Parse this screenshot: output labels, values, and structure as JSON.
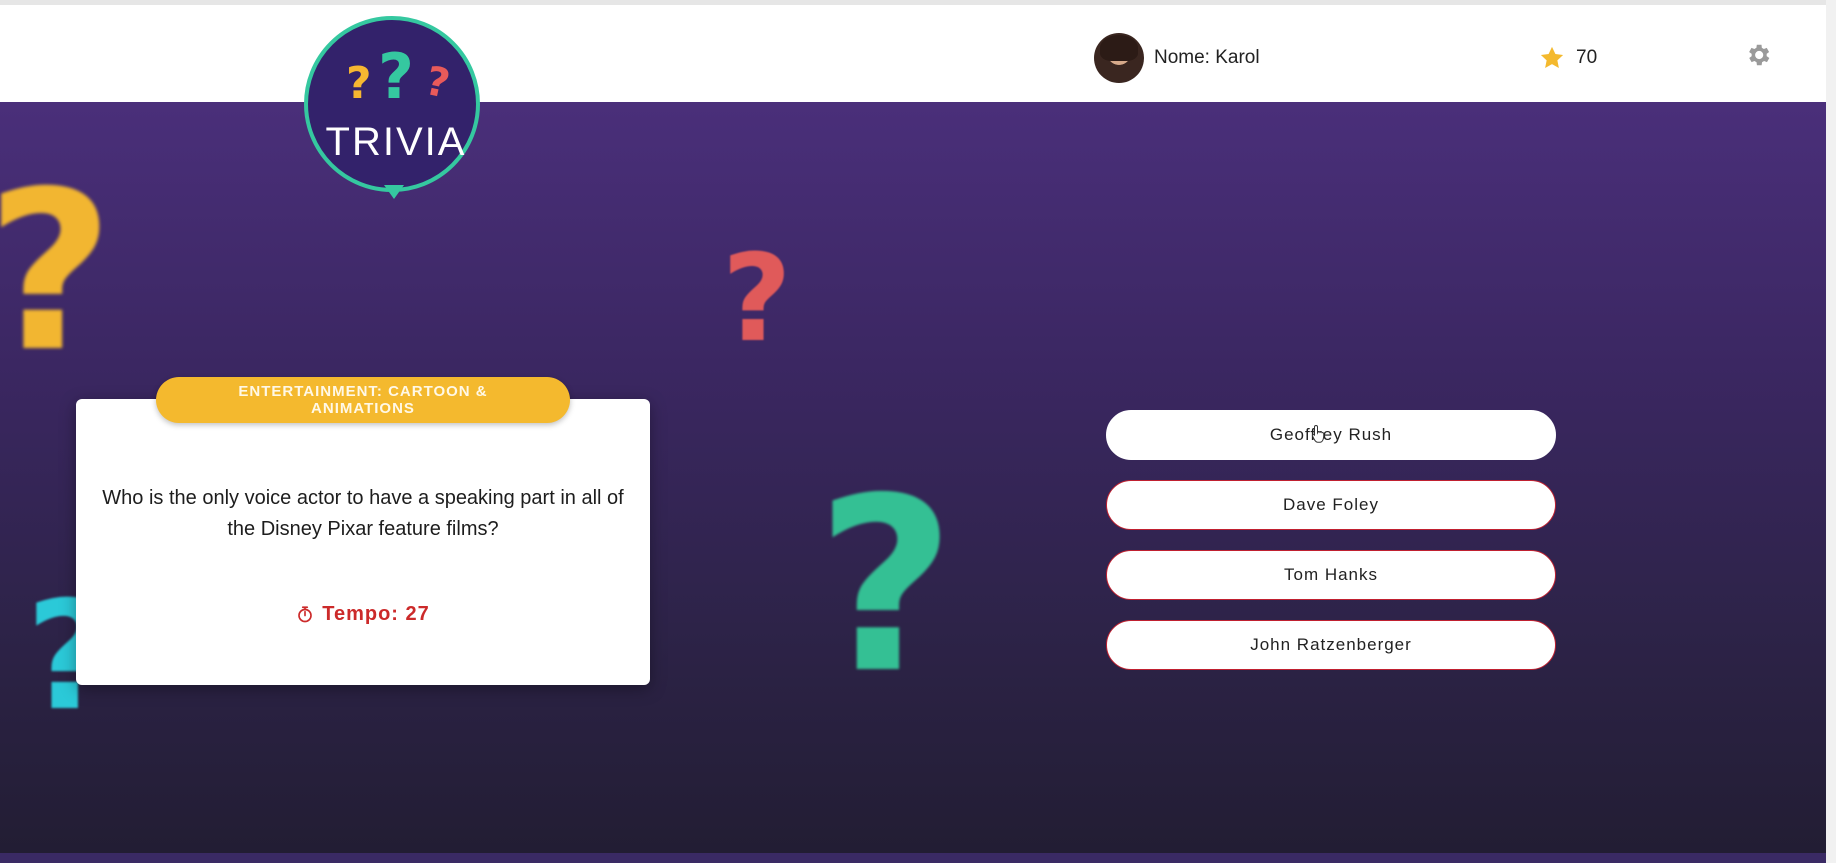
{
  "header": {
    "logo": {
      "text": "TRIVIA",
      "marks": [
        "?",
        "?",
        "?"
      ]
    },
    "user": {
      "name_label": "Nome: Karol",
      "avatar_icon": "user-avatar"
    },
    "score": {
      "value": "70",
      "icon": "star-icon",
      "icon_color": "#f4b92e"
    },
    "settings_icon": "gear-icon"
  },
  "decorations": {
    "marks": [
      "?",
      "?",
      "?",
      "?"
    ],
    "colors": [
      "#f2b631",
      "#e05a5a",
      "#34c094",
      "#2bc9d8"
    ]
  },
  "question_card": {
    "category": "ENTERTAINMENT: CARTOON & ANIMATIONS",
    "question": "Who is the only voice actor to have a speaking part in all of the Disney Pixar feature films?",
    "timer_label": "Tempo: 27",
    "timer_icon": "stopwatch-icon",
    "category_color": "#f4b92e",
    "timer_color": "#cc2a2a"
  },
  "answers": [
    "Geoffrey Rush",
    "Dave Foley",
    "Tom Hanks",
    "John Ratzenberger"
  ],
  "theme": {
    "background_top": "#4a2f7a",
    "background_bottom": "#221d33",
    "accent_green": "#35c8a0"
  }
}
